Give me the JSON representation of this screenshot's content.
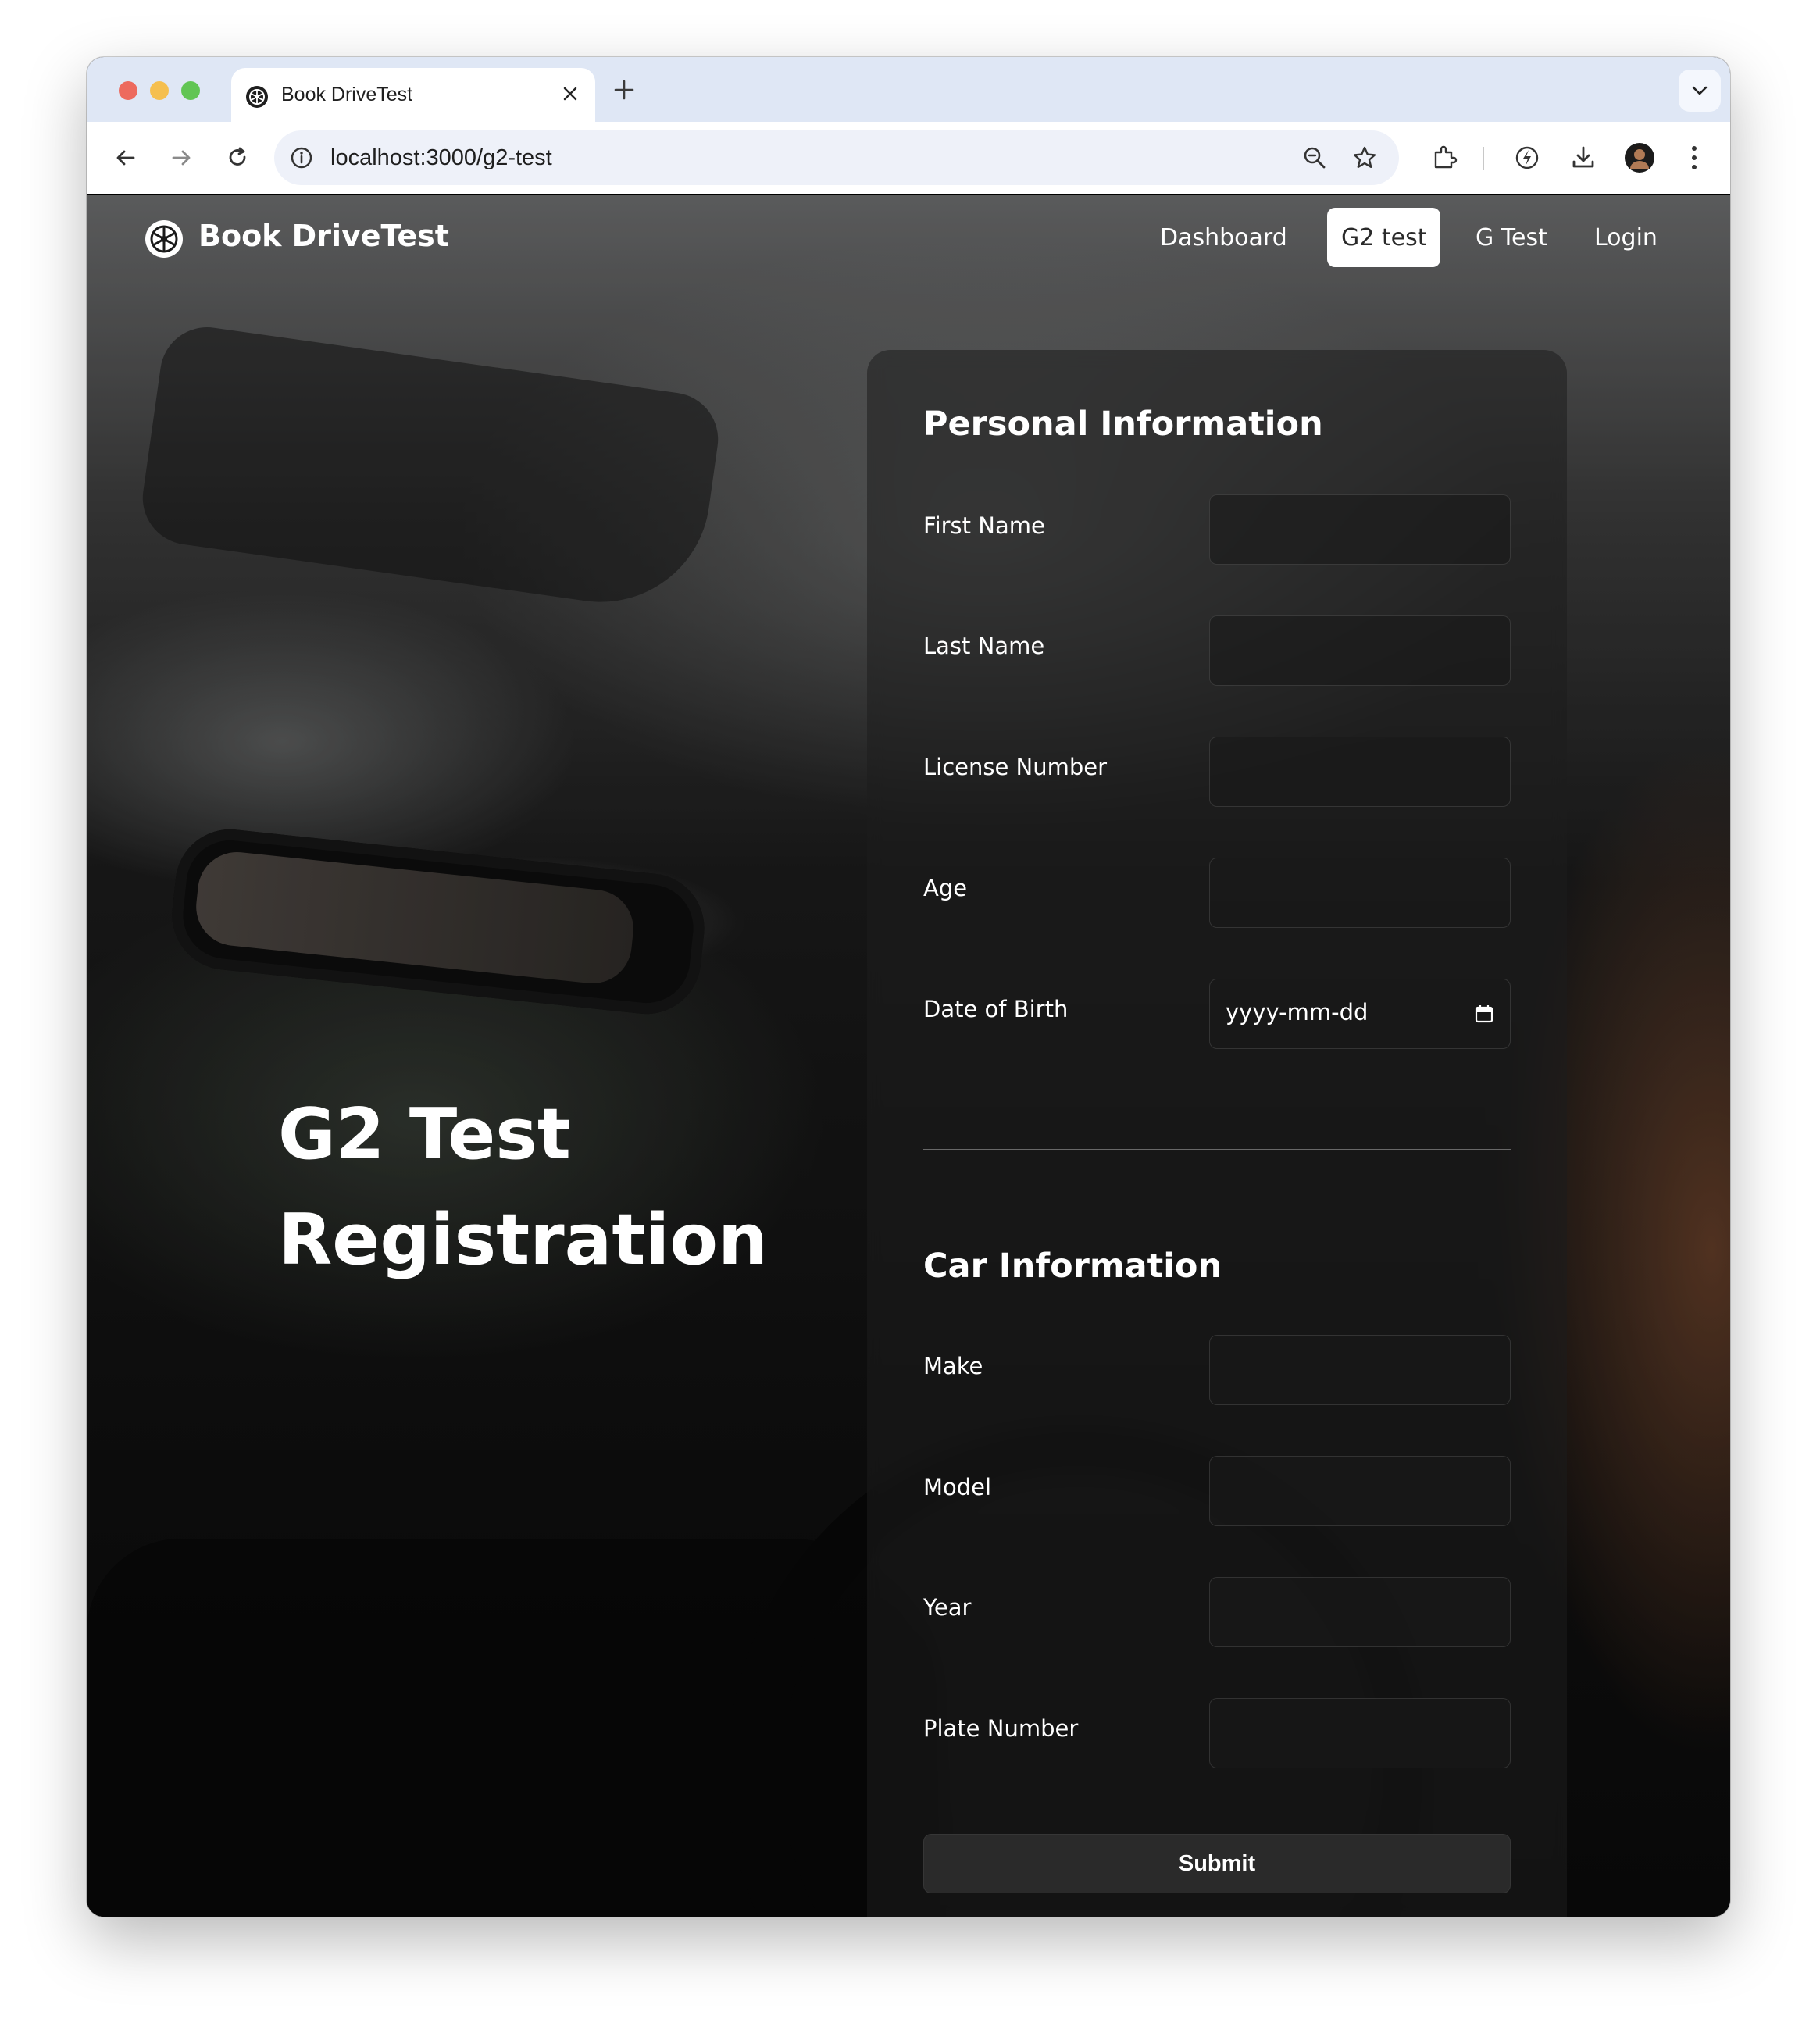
{
  "browser": {
    "tab_title": "Book DriveTest",
    "url": "localhost:3000/g2-test",
    "icons": [
      "back-icon",
      "forward-icon",
      "reload-icon",
      "info-icon",
      "zoom-icon",
      "star-icon",
      "extensions-icon",
      "performance-icon",
      "download-icon",
      "profile-avatar",
      "kebab-menu-icon"
    ]
  },
  "nav": {
    "brand": "Book DriveTest",
    "links": [
      {
        "label": "Dashboard",
        "active": false
      },
      {
        "label": "G2 test",
        "active": true
      },
      {
        "label": "G Test",
        "active": false
      },
      {
        "label": "Login",
        "active": false
      }
    ]
  },
  "hero": {
    "line1": "G2 Test",
    "line2": "Registration"
  },
  "form": {
    "personal_title": "Personal Information",
    "personal_fields": [
      {
        "label": "First Name",
        "value": ""
      },
      {
        "label": "Last Name",
        "value": ""
      },
      {
        "label": "License Number",
        "value": ""
      },
      {
        "label": "Age",
        "value": ""
      },
      {
        "label": "Date of Birth",
        "placeholder": "yyyy-mm-dd"
      }
    ],
    "car_title": "Car Information",
    "car_fields": [
      {
        "label": "Make",
        "value": ""
      },
      {
        "label": "Model",
        "value": ""
      },
      {
        "label": "Year",
        "value": ""
      },
      {
        "label": "Plate Number",
        "value": ""
      }
    ],
    "submit_label": "Submit"
  },
  "colors": {
    "nav_active_bg": "#ffffff",
    "panel_bg": "#1e1e1e",
    "submit_bg": "#2a2a2a",
    "tabstrip_bg": "#dfe7f5"
  }
}
